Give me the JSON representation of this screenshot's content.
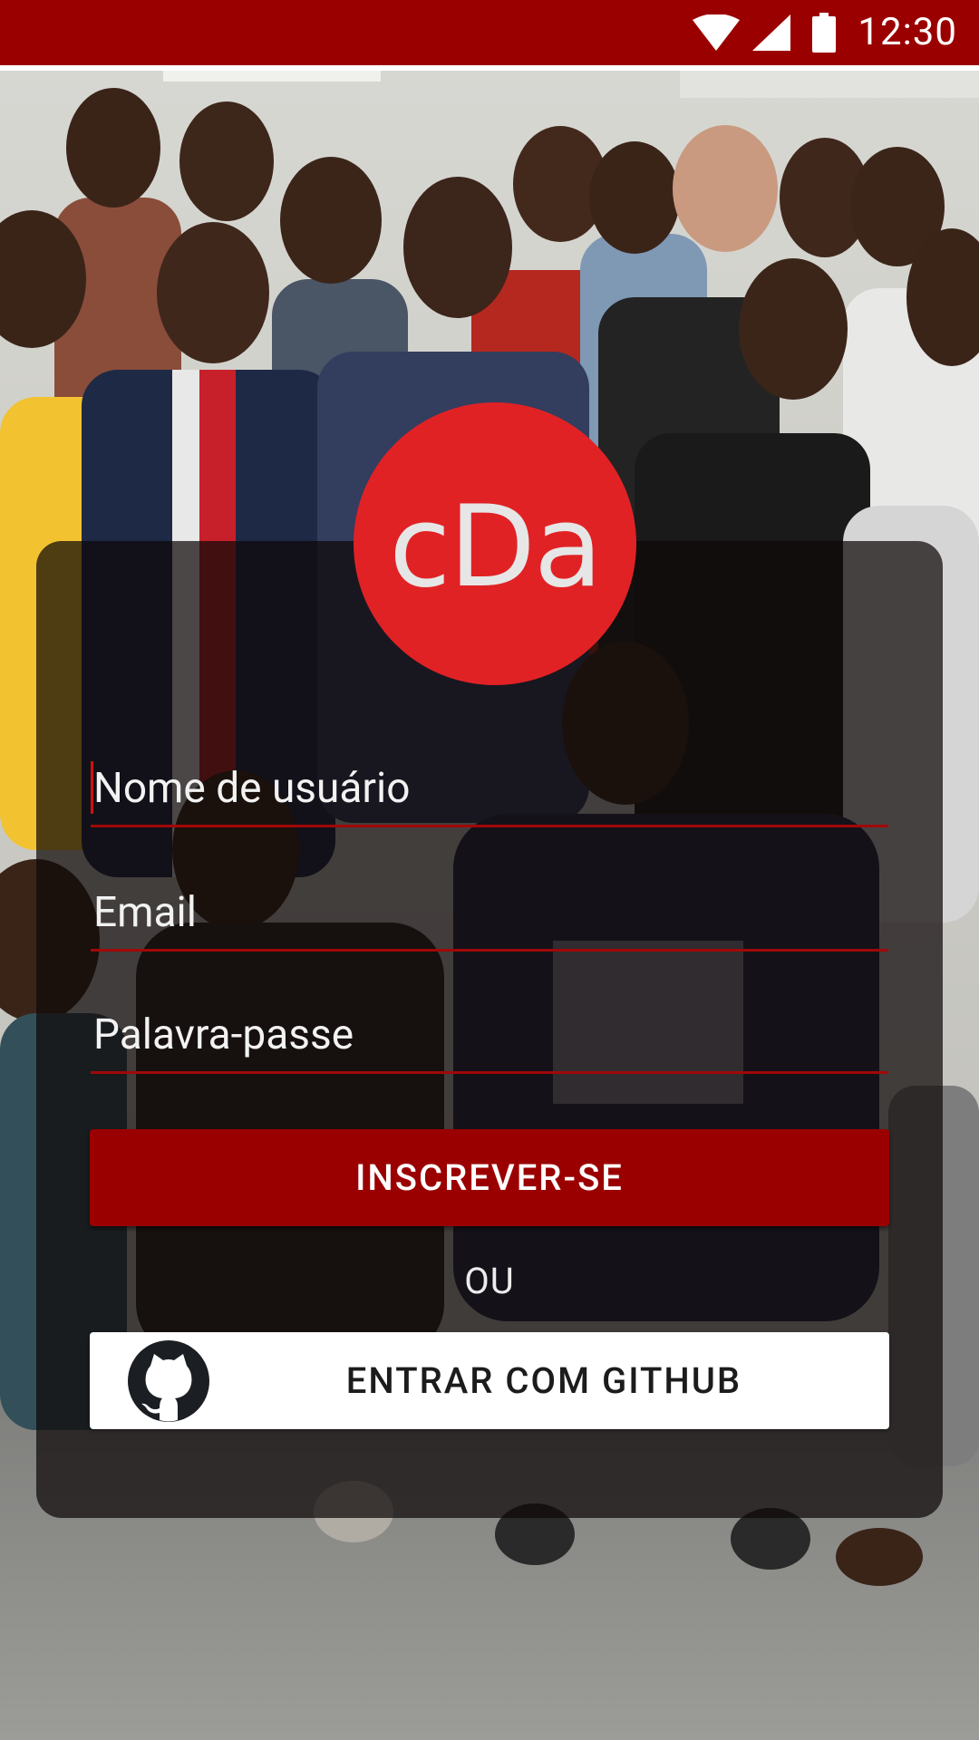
{
  "status_bar": {
    "time": "12:30",
    "background_color": "#9b0000",
    "icons": [
      "wifi-icon",
      "signal-icon",
      "battery-icon"
    ]
  },
  "logo": {
    "text": "cDa",
    "color": "#e12225"
  },
  "form": {
    "username_placeholder": "Nome de usuário",
    "email_placeholder": "Email",
    "password_placeholder": "Palavra-passe",
    "signup_label": "INSCREVER-SE",
    "divider_text": "OU",
    "github_label": "ENTRAR COM GITHUB",
    "github_icon": "github-icon",
    "accent_color": "#9b0000"
  }
}
